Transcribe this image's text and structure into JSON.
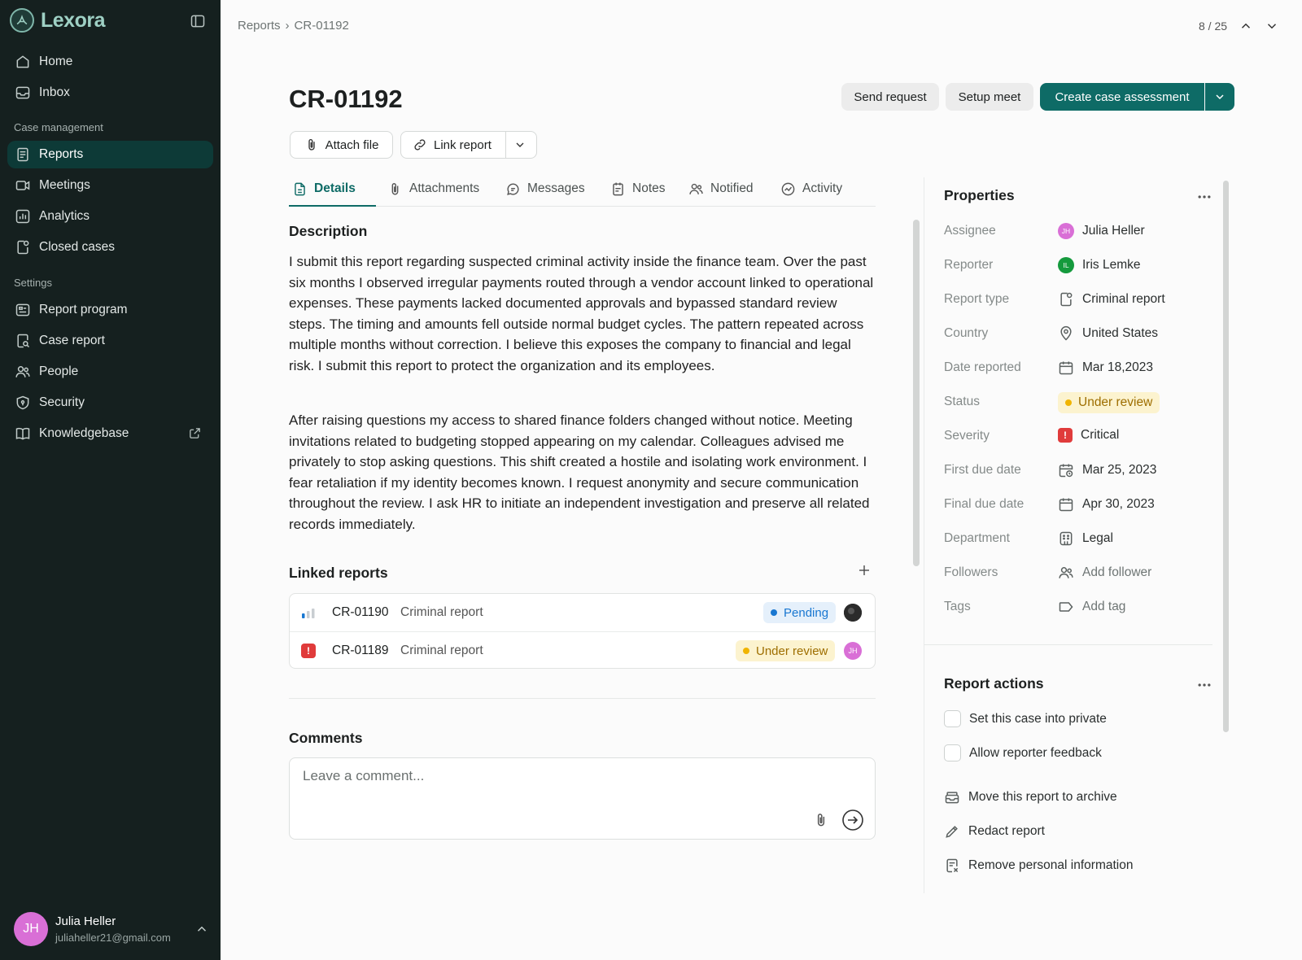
{
  "app": {
    "name": "Lexora"
  },
  "sidebar": {
    "nav": [
      {
        "label": "Home"
      },
      {
        "label": "Inbox"
      }
    ],
    "case_section": "Case management",
    "case_items": [
      {
        "label": "Reports"
      },
      {
        "label": "Meetings"
      },
      {
        "label": "Analytics"
      },
      {
        "label": "Closed cases"
      }
    ],
    "settings_section": "Settings",
    "settings_items": [
      {
        "label": "Report program"
      },
      {
        "label": "Case report"
      },
      {
        "label": "People"
      },
      {
        "label": "Security"
      },
      {
        "label": "Knowledgebase"
      }
    ],
    "user": {
      "initials": "JH",
      "name": "Julia Heller",
      "email": "juliaheller21@gmail.com"
    }
  },
  "topbar": {
    "breadcrumb": [
      "Reports",
      "›",
      "CR-01192"
    ],
    "pager": "8 / 25"
  },
  "header": {
    "title": "CR-01192",
    "send_request": "Send request",
    "setup_meet": "Setup meet",
    "create_assessment": "Create case assessment",
    "attach_file": "Attach file",
    "link_report": "Link report"
  },
  "tabs": [
    {
      "label": "Details"
    },
    {
      "label": "Attachments"
    },
    {
      "label": "Messages"
    },
    {
      "label": "Notes"
    },
    {
      "label": "Notified"
    },
    {
      "label": "Activity"
    }
  ],
  "description": {
    "heading": "Description",
    "p1": "I submit this report regarding suspected criminal activity inside the finance team. Over the past six months I observed irregular payments routed through a vendor account linked to operational expenses. These payments lacked documented approvals and bypassed standard review steps. The timing and amounts fell outside normal budget cycles. The pattern repeated across multiple months without correction. I believe this exposes the company to financial and legal risk. I submit this report to protect the organization and its employees.",
    "p2": "After raising questions my access to shared finance folders changed without notice. Meeting invitations related to budgeting stopped appearing on my calendar. Colleagues advised me privately to stop asking questions. This shift created a hostile and isolating work environment. I fear retaliation if my identity becomes known. I request anonymity and secure communication throughout the review. I ask HR to initiate an independent investigation and preserve all related records immediately."
  },
  "linked": {
    "heading": "Linked reports",
    "rows": [
      {
        "id": "CR-01190",
        "type": "Criminal report",
        "status": "Pending"
      },
      {
        "id": "CR-01189",
        "type": "Criminal report",
        "status": "Under review",
        "avatar": "JH"
      }
    ]
  },
  "comments": {
    "heading": "Comments",
    "placeholder": "Leave a comment..."
  },
  "properties": {
    "heading": "Properties",
    "assignee_label": "Assignee",
    "assignee": "Julia Heller",
    "assignee_initials": "JH",
    "reporter_label": "Reporter",
    "reporter": "Iris Lemke",
    "reporter_initials": "IL",
    "type_label": "Report type",
    "type": "Criminal report",
    "country_label": "Country",
    "country": "United States",
    "date_label": "Date reported",
    "date": "Mar 18,2023",
    "status_label": "Status",
    "status": "Under review",
    "severity_label": "Severity",
    "severity": "Critical",
    "first_due_label": "First due date",
    "first_due": "Mar 25, 2023",
    "final_due_label": "Final due date",
    "final_due": "Apr 30, 2023",
    "department_label": "Department",
    "department": "Legal",
    "followers_label": "Followers",
    "followers": "Add follower",
    "tags_label": "Tags",
    "tags": "Add tag"
  },
  "actions": {
    "heading": "Report actions",
    "private": "Set this case into private",
    "feedback": "Allow reporter feedback",
    "archive": "Move this report to archive",
    "redact": "Redact report",
    "remove_pi": "Remove personal information"
  },
  "colors": {
    "primary": "#0e6b66",
    "sidebar": "#15201f",
    "warning": "#f0b400",
    "info": "#1877d1",
    "danger": "#e03b3b"
  }
}
